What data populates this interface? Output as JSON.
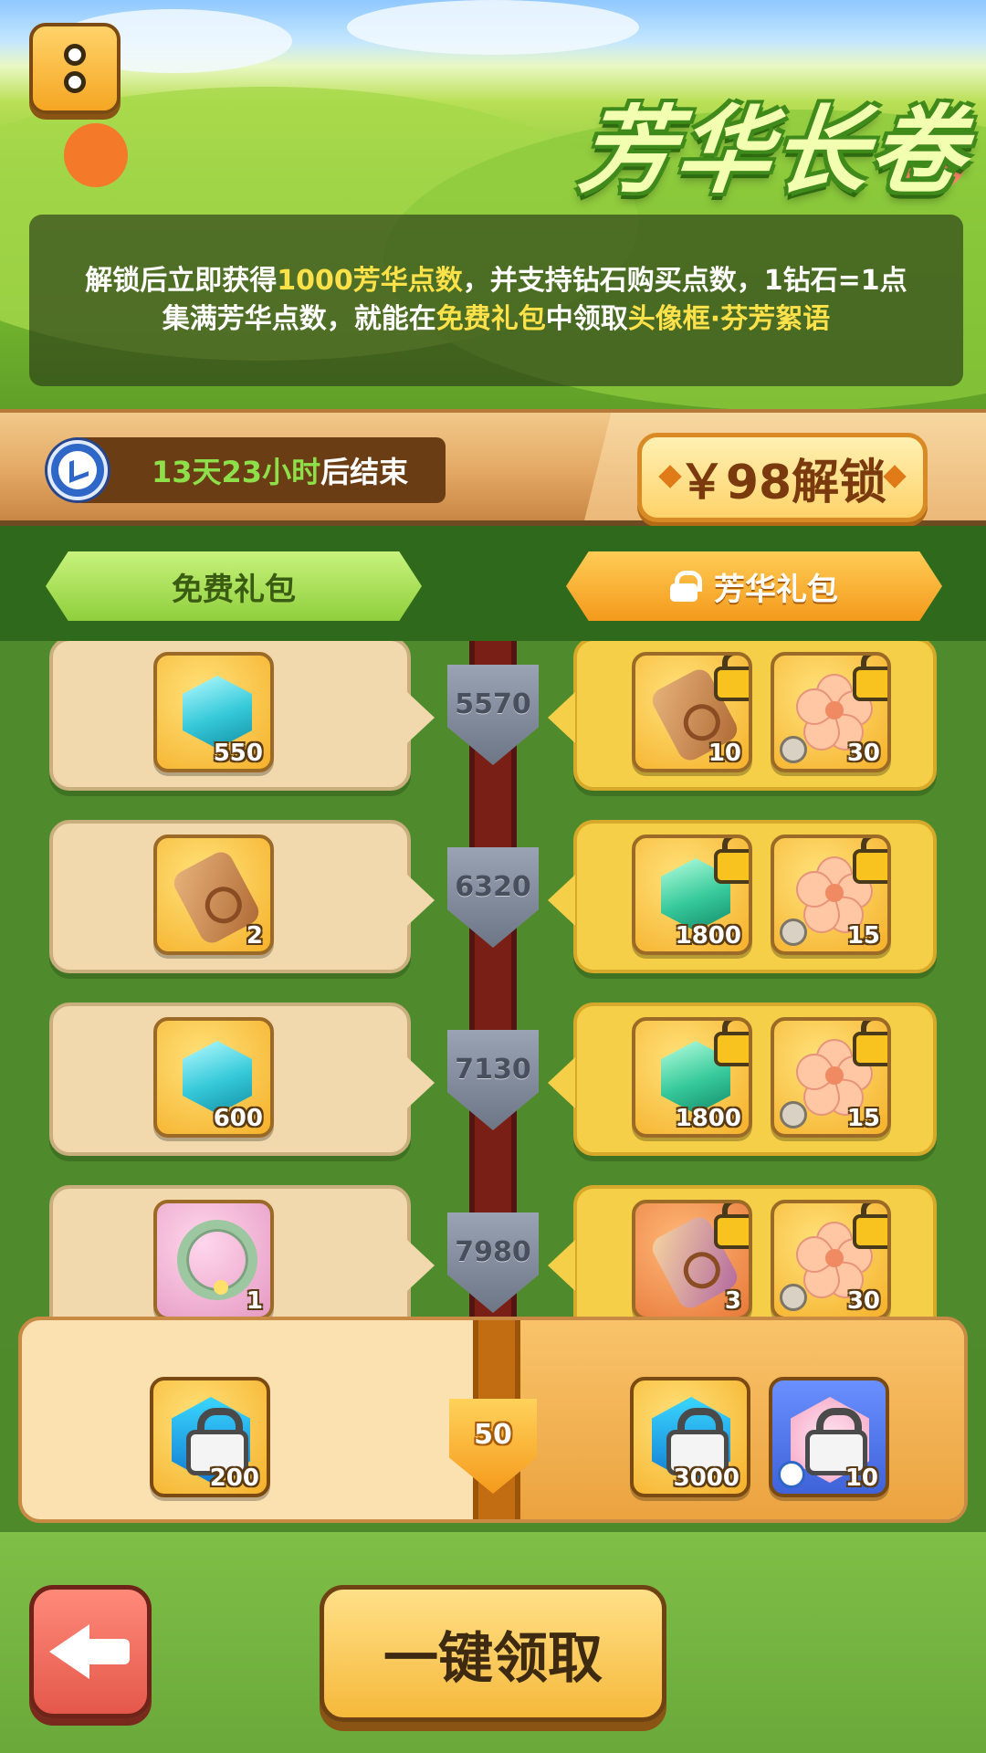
{
  "header": {
    "title": "芳华长卷",
    "description": {
      "line1": {
        "a": "解锁后立即获得",
        "b": "1000芳华点数",
        "c": "，并支持钻石购买点数，1钻石=1点"
      },
      "line2": {
        "a": "集满芳华点数，就能在",
        "b": "免费礼包",
        "c": "中领取",
        "d": "头像框·芬芳絮语"
      }
    }
  },
  "timer": {
    "highlight": "13天23小时",
    "suffix": "后结束"
  },
  "unlock_button": {
    "label": "￥98解锁"
  },
  "tabs": {
    "free": "免费礼包",
    "premium": "芳华礼包"
  },
  "track": {
    "rows": [
      {
        "level": "5570",
        "free": {
          "icon": "diamond-icon",
          "qty": "550"
        },
        "premium": [
          {
            "icon": "scroll-icon",
            "qty": "10"
          },
          {
            "icon": "blossom-icon",
            "qty": "30"
          }
        ]
      },
      {
        "level": "6320",
        "free": {
          "icon": "scroll-icon",
          "qty": "2"
        },
        "premium": [
          {
            "icon": "green-gem-icon",
            "qty": "1800"
          },
          {
            "icon": "blossom-icon",
            "qty": "15"
          }
        ]
      },
      {
        "level": "7130",
        "free": {
          "icon": "diamond-icon",
          "qty": "600"
        },
        "premium": [
          {
            "icon": "green-gem-icon",
            "qty": "1800"
          },
          {
            "icon": "blossom-icon",
            "qty": "15"
          }
        ]
      },
      {
        "level": "7980",
        "free": {
          "icon": "wreath-frame-icon",
          "qty": "1"
        },
        "premium": [
          {
            "icon": "purple-scroll-icon",
            "qty": "3"
          },
          {
            "icon": "blossom-icon",
            "qty": "30"
          }
        ]
      }
    ]
  },
  "bonus": {
    "level": "50",
    "free": {
      "icon": "locked-diamond-icon",
      "qty": "200"
    },
    "premium": [
      {
        "icon": "locked-diamond-icon",
        "qty": "3000"
      },
      {
        "icon": "locked-blossom-icon",
        "qty": "10"
      }
    ]
  },
  "footer": {
    "claim_all": "一键领取"
  },
  "colors": {
    "highlight": "#ffe14a",
    "timer_green": "#8ee04a",
    "accent_orange": "#f49a1c"
  }
}
